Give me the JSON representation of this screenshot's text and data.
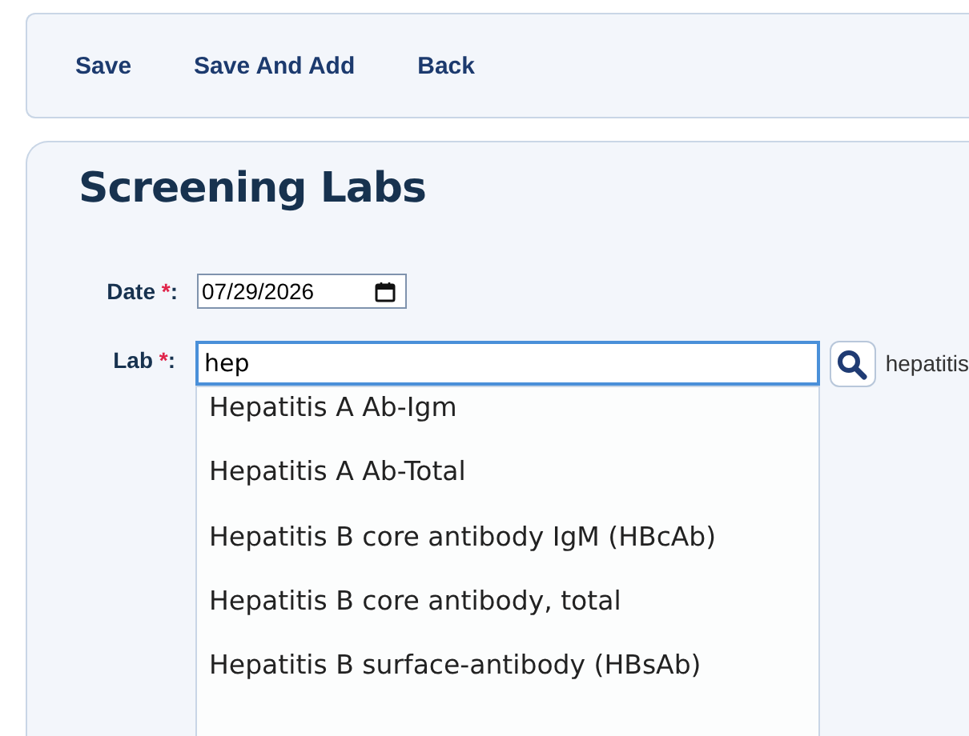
{
  "toolbar": {
    "buttons": [
      "Save",
      "Save And Add",
      "Back"
    ]
  },
  "form": {
    "title": "Screening Labs",
    "date": {
      "label": "Date",
      "required_mark": "*",
      "colon": ":",
      "value": "07/29/2026"
    },
    "lab": {
      "label": "Lab",
      "required_mark": "*",
      "colon": ":",
      "value": "hep",
      "side_text": "hepatitis"
    },
    "suggestions": [
      {
        "label": "Hepatitis A Ab-Igm"
      },
      {
        "label": "Hepatitis A Ab-Total"
      },
      {
        "label": "Hepatitis B core antibody IgM (HBcAb)"
      },
      {
        "label": "Hepatitis B core antibody, total"
      },
      {
        "label": "Hepatitis B surface-antibody (HBsAb)"
      }
    ]
  }
}
